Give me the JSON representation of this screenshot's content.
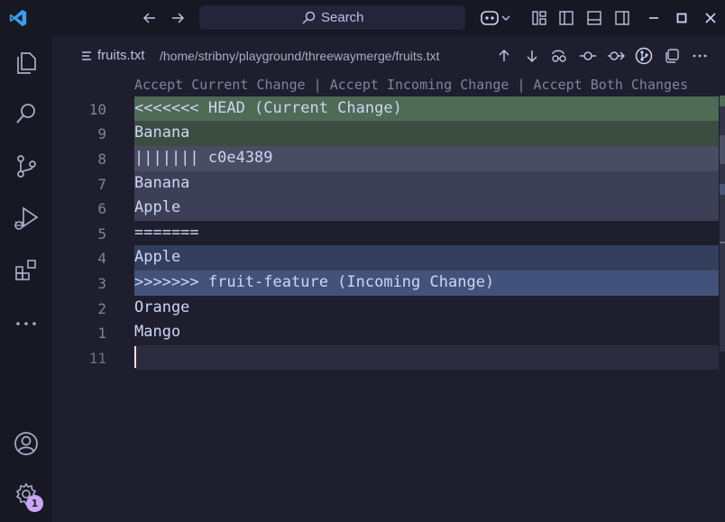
{
  "titlebar": {
    "search_placeholder": "Search"
  },
  "editor": {
    "file_name": "fruits.txt",
    "file_path": "/home/stribny/playground/threewaymerge/fruits.txt",
    "codelens": {
      "accept_current": "Accept Current Change",
      "sep1": " | ",
      "accept_incoming": "Accept Incoming Change",
      "sep2": " | ",
      "accept_both": "Accept Both Changes"
    },
    "lines": [
      {
        "num": "10",
        "text": "<<<<<<< HEAD (Current Change)"
      },
      {
        "num": "9",
        "text": "Banana"
      },
      {
        "num": "8",
        "text": "||||||| c0e4389"
      },
      {
        "num": "7",
        "text": "Banana"
      },
      {
        "num": "6",
        "text": "Apple"
      },
      {
        "num": "5",
        "text": "======="
      },
      {
        "num": "4",
        "text": "Apple"
      },
      {
        "num": "3",
        "text": ">>>>>>> fruit-feature (Incoming Change)"
      },
      {
        "num": "2",
        "text": "Orange"
      },
      {
        "num": "1",
        "text": "Mango"
      },
      {
        "num": "11",
        "text": ""
      }
    ]
  },
  "activitybar": {
    "settings_badge": "1"
  },
  "colors": {
    "current_header": "#4f6a55",
    "current_body": "#3a4d40",
    "base_header": "#4a4c63",
    "base_body": "#3d3f56",
    "incoming_header": "#42527a",
    "incoming_body": "#333e5c",
    "active_line": "#2a2b3d",
    "accent": "#cba6f7",
    "vscode_blue": "#3e9ded"
  }
}
